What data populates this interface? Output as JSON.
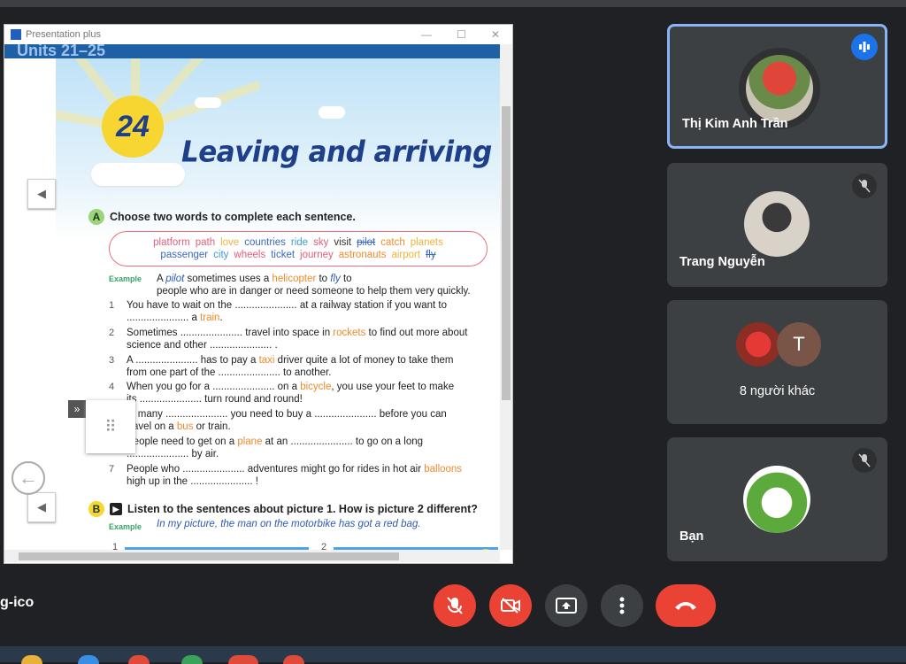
{
  "window": {
    "title": "Presentation plus",
    "header_partial": "Units 21–25",
    "minimize": "—",
    "maximize": "☐",
    "close": "✕"
  },
  "book": {
    "unit_number": "24",
    "unit_title": "Leaving and arriving",
    "section_a": {
      "letter": "A",
      "instruction": "Choose two words to complete each sentence.",
      "wordbank_row1": [
        {
          "text": "platform",
          "color": "#e35d7c",
          "crossed": false
        },
        {
          "text": "path",
          "color": "#e35d7c",
          "crossed": false
        },
        {
          "text": "love",
          "color": "#f2b23a",
          "crossed": false
        },
        {
          "text": "countries",
          "color": "#3b66c4",
          "crossed": false
        },
        {
          "text": "ride",
          "color": "#3a9cd6",
          "crossed": false
        },
        {
          "text": "sky",
          "color": "#e35d7c",
          "crossed": false
        },
        {
          "text": "visit",
          "color": "#333333",
          "crossed": false
        },
        {
          "text": "pilot",
          "color": "#3b66c4",
          "crossed": true
        },
        {
          "text": "catch",
          "color": "#f08a2b",
          "crossed": false
        },
        {
          "text": "planets",
          "color": "#f2b23a",
          "crossed": false
        }
      ],
      "wordbank_row2": [
        {
          "text": "passenger",
          "color": "#3b66c4",
          "crossed": false
        },
        {
          "text": "city",
          "color": "#3a9cd6",
          "crossed": false
        },
        {
          "text": "wheels",
          "color": "#e35d7c",
          "crossed": false
        },
        {
          "text": "ticket",
          "color": "#3b66c4",
          "crossed": false
        },
        {
          "text": "journey",
          "color": "#e35d7c",
          "crossed": false
        },
        {
          "text": "astronauts",
          "color": "#f08a2b",
          "crossed": false
        },
        {
          "text": "airport",
          "color": "#f2b23a",
          "crossed": false
        },
        {
          "text": "fly",
          "color": "#3b66c4",
          "crossed": true
        }
      ],
      "example_label": "Example",
      "example": {
        "p1": "A ",
        "blank1": "pilot",
        "p2": " sometimes uses a ",
        "kw": "helicopter",
        "p3": " to ",
        "blank2": "fly",
        "p4": " to",
        "line2": "people who are in danger or need someone to help them very quickly."
      },
      "items": [
        {
          "n": "1",
          "a": "You have to wait on the ...................... at a railway station if you want to",
          "b": "...................... a ",
          "b_kw": "train",
          "b_end": "."
        },
        {
          "n": "2",
          "a_pre": "Sometimes ...................... travel into space in ",
          "a_kw": "rockets",
          "a_post": " to find out more about",
          "b": "science and other ...................... .",
          "b_kw": "",
          "b_end": ""
        },
        {
          "n": "3",
          "a_pre": "A ...................... has to pay a ",
          "a_kw": "taxi",
          "a_post": " driver quite a lot of money to take them",
          "b": "from one part of the ...................... to another.",
          "b_kw": "",
          "b_end": ""
        },
        {
          "n": "4",
          "a_pre": "When you go for a ...................... on a ",
          "a_kw": "bicycle",
          "a_post": ", you use your feet to make",
          "b": "its ...................... turn round and round!",
          "b_kw": "",
          "b_end": ""
        },
        {
          "n": "5",
          "a_pre": "In many ...................... you need to buy a ...................... before you can",
          "a_kw": "",
          "a_post": "",
          "b": "travel on a ",
          "b_kw": "bus",
          "b_end": " or train."
        },
        {
          "n": "6",
          "a_pre": "People need to get on a ",
          "a_kw": "plane",
          "a_post": " at an ...................... to go on a long",
          "b": "...................... by air.",
          "b_kw": "",
          "b_end": ""
        },
        {
          "n": "7",
          "a_pre": "People who ...................... adventures might go for rides in hot air ",
          "a_kw": "balloons",
          "a_post": "",
          "b": "high up in the ...................... !",
          "b_kw": "",
          "b_end": ""
        }
      ]
    },
    "section_b": {
      "letter": "B",
      "instruction": "Listen to the sentences about picture 1. How is picture 2 different?",
      "example_label": "Example",
      "example": "In my picture, the man on the motorbike has got a red bag.",
      "pic1": "1",
      "pic2": "2"
    }
  },
  "participants": [
    {
      "name": "Thị Kim Anh Trần",
      "speaking": true,
      "muted": false
    },
    {
      "name": "Trang Nguyễn",
      "speaking": false,
      "muted": true
    },
    {
      "name": "8 người khác",
      "initial": "T"
    },
    {
      "name": "Bạn",
      "speaking": false,
      "muted": true
    }
  ],
  "meeting_name": "g-ico",
  "controls": [
    {
      "name": "mic-toggle",
      "icon": "mic-off-icon",
      "color": "#ea4335"
    },
    {
      "name": "camera-toggle",
      "icon": "camera-off-icon",
      "color": "#ea4335"
    },
    {
      "name": "present",
      "icon": "present-screen-icon",
      "color": "#3c4043"
    },
    {
      "name": "more-options",
      "icon": "more-vert-icon",
      "color": "#3c4043"
    },
    {
      "name": "leave-call",
      "icon": "hang-up-icon",
      "color": "#ea4335"
    }
  ]
}
